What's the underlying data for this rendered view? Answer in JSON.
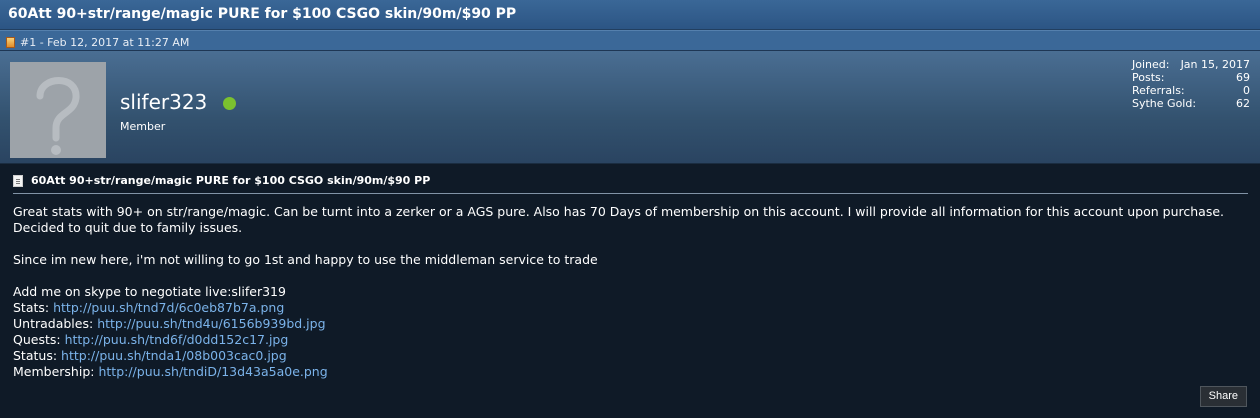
{
  "thread": {
    "title": "60Att 90+str/range/magic PURE for $100 CSGO skin/90m/$90 PP"
  },
  "post_meta": {
    "label": "#1 - Feb 12, 2017 at 11:27 AM"
  },
  "user": {
    "username": "slifer323",
    "title": "Member",
    "online": true,
    "online_color": "#7bc12f",
    "stats": [
      {
        "label": "Joined:",
        "value": "Jan 15, 2017"
      },
      {
        "label": "Posts:",
        "value": "69"
      },
      {
        "label": "Referrals:",
        "value": "0"
      },
      {
        "label": "Sythe Gold:",
        "value": "62"
      }
    ]
  },
  "post": {
    "title": "60Att 90+str/range/magic PURE for $100 CSGO skin/90m/$90 PP",
    "paragraph1": "Great stats with 90+ on str/range/magic. Can be turnt into a zerker or a AGS pure. Also has 70 Days of membership on this account. I will provide all information for this account upon purchase. Decided to quit due to family issues.",
    "paragraph2": "Since im new here, i'm not willing to go 1st and happy to use the middleman service to trade",
    "skype_line": "Add me on skype to negotiate live:slifer319",
    "links": [
      {
        "label": "Stats:",
        "url": "http://puu.sh/tnd7d/6c0eb87b7a.png"
      },
      {
        "label": "Untradables:",
        "url": "http://puu.sh/tnd4u/6156b939bd.jpg"
      },
      {
        "label": "Quests:",
        "url": "http://puu.sh/tnd6f/d0dd152c17.jpg"
      },
      {
        "label": "Status:",
        "url": "http://puu.sh/tnda1/08b003cac0.jpg"
      },
      {
        "label": "Membership:",
        "url": "http://puu.sh/tndiD/13d43a5a0e.png"
      }
    ]
  },
  "actions": {
    "share_label": "Share"
  },
  "colors": {
    "header_blue": "#2c5584",
    "link": "#7bb3ea",
    "background": "#0f1a27"
  }
}
